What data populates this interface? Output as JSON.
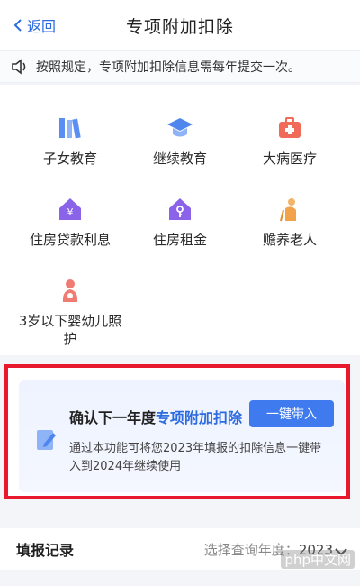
{
  "header": {
    "back_label": "返回",
    "title": "专项附加扣除"
  },
  "notice": {
    "text": "按照规定，专项附加扣除信息需每年提交一次。"
  },
  "grid": {
    "items": [
      {
        "label": "子女教育",
        "icon": "books-icon"
      },
      {
        "label": "继续教育",
        "icon": "graduation-cap-icon"
      },
      {
        "label": "大病医疗",
        "icon": "medical-kit-icon"
      },
      {
        "label": "住房贷款利息",
        "icon": "house-yen-icon"
      },
      {
        "label": "住房租金",
        "icon": "house-key-icon"
      },
      {
        "label": "赡养老人",
        "icon": "elderly-icon"
      },
      {
        "label": "3岁以下婴幼儿照护",
        "icon": "mother-baby-icon"
      }
    ]
  },
  "banner": {
    "title_prefix": "确认下一年度",
    "title_highlight": "专项附加扣除",
    "button_label": "一键带入",
    "description": "通过本功能可将您2023年填报的扣除信息一键带入到2024年继续使用"
  },
  "record": {
    "label": "填报记录",
    "year_prompt": "选择查询年度：",
    "year_value": "2023"
  },
  "watermark": "php中文网",
  "colors": {
    "accent": "#2d6be0",
    "button": "#3f7bef",
    "highlight_border": "#e8192c"
  }
}
